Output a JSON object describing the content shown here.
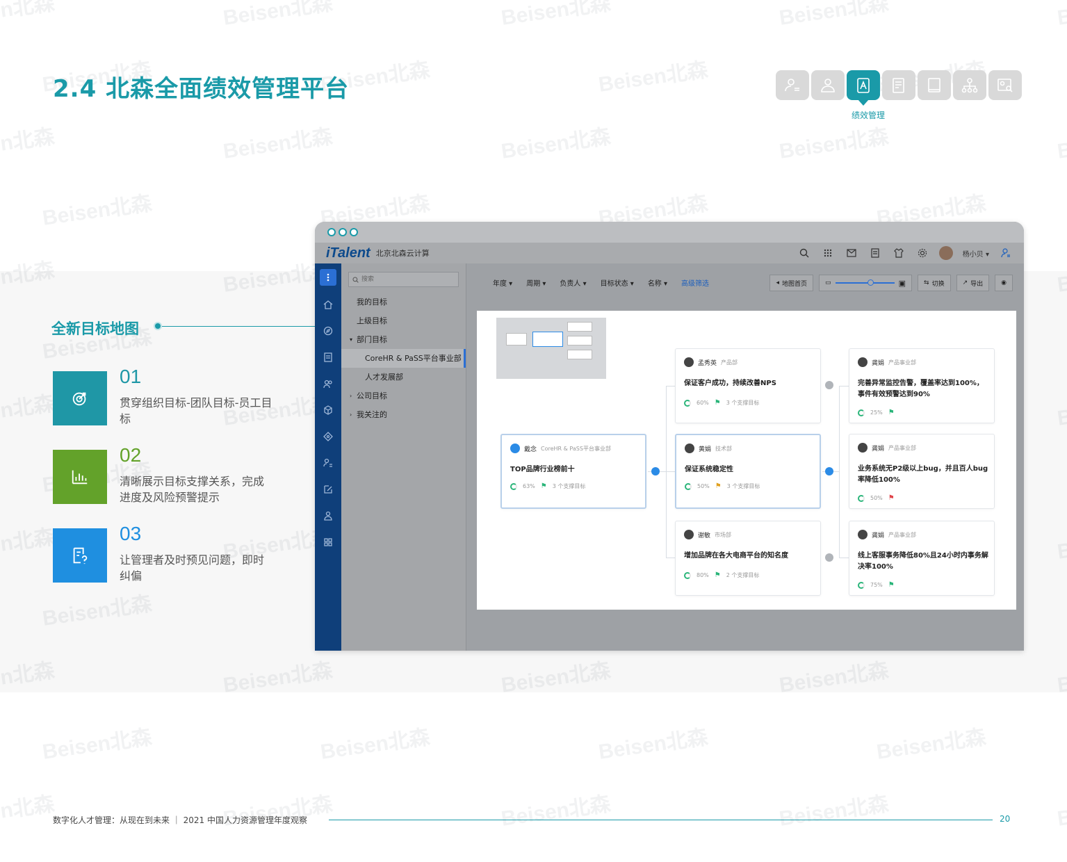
{
  "title": "2.4 北森全面绩效管理平台",
  "modules": {
    "items": [
      {
        "icon": "person-list-icon",
        "active": false
      },
      {
        "icon": "person-icon",
        "active": false
      },
      {
        "icon": "performance-icon",
        "active": true
      },
      {
        "icon": "document-icon",
        "active": false
      },
      {
        "icon": "book-icon",
        "active": false
      },
      {
        "icon": "org-chart-icon",
        "active": false
      },
      {
        "icon": "profile-search-icon",
        "active": false
      }
    ],
    "active_label": "绩效管理"
  },
  "section": {
    "heading": "全新目标地图",
    "features": [
      {
        "num": "01",
        "desc": "贯穿组织目标-团队目标-员工目标",
        "color": "#1f97a6",
        "icon": "target-icon"
      },
      {
        "num": "02",
        "desc": "清晰展示目标支撑关系，完成进度及风险预警提示",
        "color": "#63a22a",
        "icon": "chart-icon"
      },
      {
        "num": "03",
        "desc": "让管理者及时预见问题，即时纠偏",
        "color": "#1f8fe0",
        "icon": "question-doc-icon"
      }
    ]
  },
  "app": {
    "logo": "iTalent",
    "company": "北京北森云计算",
    "username": "杨小贝 ▾",
    "search_placeholder": "搜索",
    "tree": [
      {
        "label": "我的目标",
        "level": 0,
        "caret": ""
      },
      {
        "label": "上级目标",
        "level": 0,
        "caret": ""
      },
      {
        "label": "部门目标",
        "level": 0,
        "caret": "▾"
      },
      {
        "label": "CoreHR & PaSS平台事业部",
        "level": 1,
        "caret": "",
        "selected": true
      },
      {
        "label": "人才发展部",
        "level": 1,
        "caret": ""
      },
      {
        "label": "公司目标",
        "level": 0,
        "caret": "›"
      },
      {
        "label": "我关注的",
        "level": 0,
        "caret": "›"
      }
    ],
    "filters": [
      "年度 ▾",
      "周期 ▾",
      "负责人 ▾",
      "目标状态 ▾",
      "名称 ▾"
    ],
    "advanced_filter": "高级筛选",
    "buttons": {
      "map_home": "地图首页",
      "switch": "切换",
      "export": "导出"
    },
    "cards": {
      "root": {
        "name": "戴念",
        "dept": "CoreHR & PaSS平台事业部",
        "title": "TOP品牌行业榜前十",
        "progress": "63%",
        "support": "3 个支撑目标"
      },
      "mid": [
        {
          "name": "孟秀英",
          "dept": "产品部",
          "title": "保证客户成功，持续改善NPS",
          "progress": "60%",
          "support": "3 个支撑目标",
          "flag": "ok"
        },
        {
          "name": "黄娟",
          "dept": "技术部",
          "title": "保证系统稳定性",
          "progress": "50%",
          "support": "3 个支撑目标",
          "flag": "warn"
        },
        {
          "name": "谢敏",
          "dept": "市场部",
          "title": "增加品牌在各大电商平台的知名度",
          "progress": "80%",
          "support": "2 个支撑目标",
          "flag": "ok"
        }
      ],
      "right": [
        {
          "name": "龚娟",
          "dept": "产品事业部",
          "title": "完善异常监控告警，覆盖率达到100%，事件有效预警达到90%",
          "progress": "25%",
          "flag": "ok"
        },
        {
          "name": "龚娟",
          "dept": "产品事业部",
          "title": "业务系统无P2级以上bug，并且百人bug率降低100%",
          "progress": "50%",
          "flag": "risk"
        },
        {
          "name": "龚娟",
          "dept": "产品事业部",
          "title": "线上客服事务降低80%且24小时内事务解决率100%",
          "progress": "75%",
          "flag": "ok"
        }
      ]
    }
  },
  "footer": {
    "text": "数字化人才管理：从现在到未来 ｜ 2021 中国人力资源管理年度观察",
    "page": "20"
  },
  "watermark": "Beisen北森"
}
